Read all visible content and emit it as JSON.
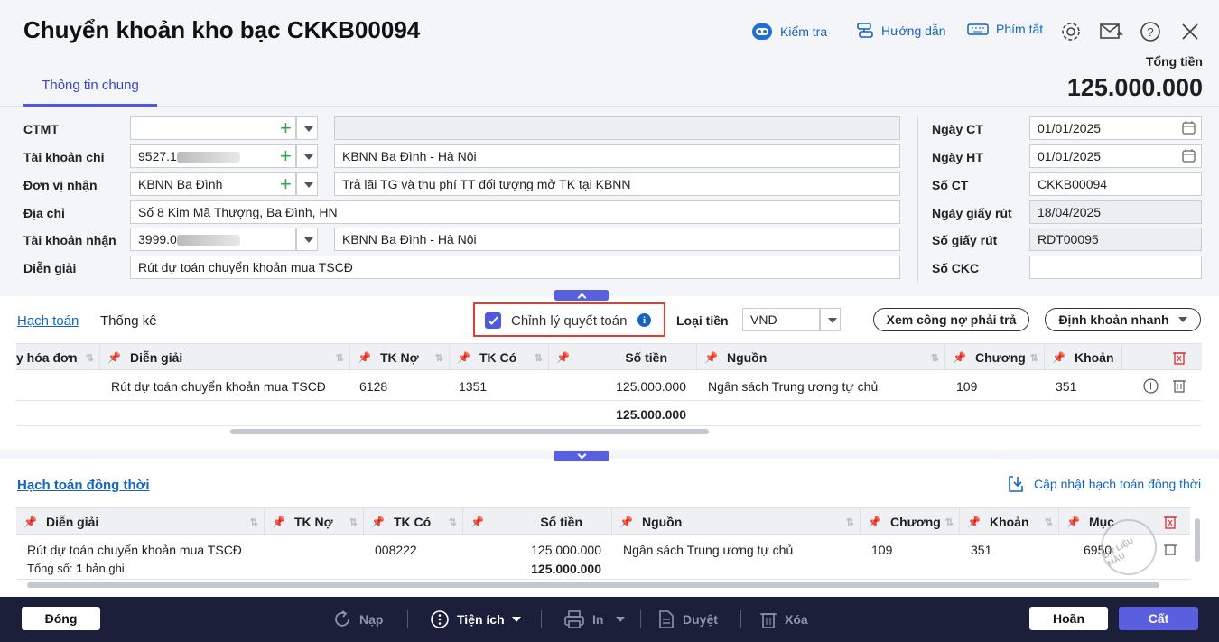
{
  "header": {
    "title": "Chuyển khoản kho bạc CKKB00094",
    "check": "Kiểm tra",
    "guide": "Hướng dẫn",
    "shortcut": "Phím tắt",
    "total_label": "Tổng tiền",
    "total_value": "125.000.000"
  },
  "tabs": {
    "general": "Thông tin chung"
  },
  "form": {
    "ctmt_label": "CTMT",
    "ctmt_value": "",
    "ctmt_desc": "",
    "acc_label": "Tài khoản chi",
    "acc_value": "9527.1",
    "acc_desc": "KBNN Ba Đình - Hà Nội",
    "unit_label": "Đơn vị nhận",
    "unit_value": "KBNN Ba Đình",
    "unit_desc": "Trả lãi TG và thu phí TT đối tượng mở TK tại KBNN",
    "addr_label": "Địa chỉ",
    "addr_value": "Số 8 Kim Mã Thượng, Ba Đình, HN",
    "racc_label": "Tài khoản nhận",
    "racc_value": "3999.0",
    "racc_desc": "KBNN Ba Đình - Hà Nội",
    "note_label": "Diễn giải",
    "note_value": "Rút dự toán chuyển khoản mua TSCĐ",
    "date_ct_label": "Ngày CT",
    "date_ct": "01/01/2025",
    "date_ht_label": "Ngày HT",
    "date_ht": "01/01/2025",
    "so_ct_label": "Số CT",
    "so_ct": "CKKB00094",
    "ngay_gr_label": "Ngày giấy rút",
    "ngay_gr": "18/04/2025",
    "so_gr_label": "Số giấy rút",
    "so_gr": "RDT00095",
    "so_ckc_label": "Số CKC",
    "so_ckc": ""
  },
  "mid": {
    "tab_accounting": "Hạch toán",
    "tab_stats": "Thống kê",
    "adjust": "Chỉnh lý quyết toán",
    "currency_label": "Loại tiền",
    "currency": "VND",
    "debt_btn": "Xem công nợ phải trả",
    "quick_btn": "Định khoản nhanh"
  },
  "grid1": {
    "headers": [
      "y hóa đơn",
      "Diễn giải",
      "TK Nợ",
      "TK Có",
      "Số tiền",
      "Nguồn",
      "Chương",
      "Khoản"
    ],
    "row": [
      "Rút dự toán chuyển khoản mua TSCĐ",
      "6128",
      "1351",
      "125.000.000",
      "Ngân sách Trung ương tự chủ",
      "109",
      "351"
    ],
    "sum": "125.000.000"
  },
  "grid2": {
    "title": "Hạch toán đồng thời",
    "update": "Cập nhật hạch toán đồng thời",
    "headers": [
      "Diễn giải",
      "TK Nợ",
      "TK Có",
      "Số tiền",
      "Nguồn",
      "Chương",
      "Khoản",
      "Mục"
    ],
    "row": [
      "Rút dự toán chuyển khoản mua TSCĐ",
      "",
      "008222",
      "125.000.000",
      "Ngân sách Trung ương tự chủ",
      "109",
      "351",
      "6950"
    ],
    "count_prefix": "Tổng số: ",
    "count": "1",
    "count_suffix": " bản ghi",
    "sum": "125.000.000",
    "watermark": "DỮ LIỆU MẪU"
  },
  "footer": {
    "close": "Đóng",
    "load": "Nạp",
    "utils": "Tiện ích",
    "print": "In",
    "approve": "Duyệt",
    "delete": "Xóa",
    "cancel": "Hoãn",
    "save": "Cất"
  },
  "colors": {
    "accent": "#5a5fe0",
    "link": "#1565c0",
    "footer": "#1c1f3a",
    "highlight": "#e53935"
  }
}
